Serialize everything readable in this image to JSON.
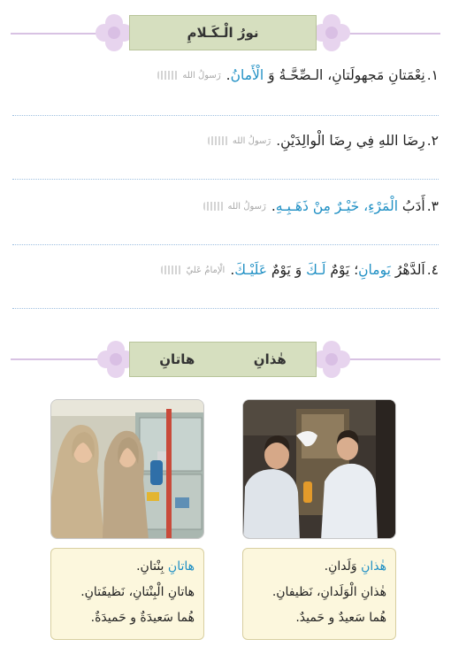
{
  "section1": {
    "title": "نورُ الْـكَـلامِ",
    "hadiths": [
      {
        "num": "١.",
        "parts": [
          {
            "t": "نِعْمَتانِ مَجهولَتانِ، الـصِّحَّـةُ وَ ",
            "c": ""
          },
          {
            "t": "الْأَمانُ",
            "c": "blue"
          },
          {
            "t": ".",
            "c": ""
          }
        ],
        "source": "رَسولُ الله"
      },
      {
        "num": "٢.",
        "parts": [
          {
            "t": "رِضَا اللهِ فِي رِضَا الْوالِدَيْنِ.",
            "c": ""
          }
        ],
        "source": "رَسولُ الله"
      },
      {
        "num": "٣.",
        "parts": [
          {
            "t": "أَدَبُ ",
            "c": ""
          },
          {
            "t": "الْمَرْءِ، خَيْـرٌ مِنْ ذَهَـبِـهِ",
            "c": "blue"
          },
          {
            "t": ".",
            "c": ""
          }
        ],
        "source": "رَسولُ الله"
      },
      {
        "num": "٤.",
        "parts": [
          {
            "t": "اَلدَّهْرُ ",
            "c": ""
          },
          {
            "t": "يَومانِ",
            "c": "blue"
          },
          {
            "t": "؛ يَوْمٌ ",
            "c": ""
          },
          {
            "t": "لَـكَ",
            "c": "blue"
          },
          {
            "t": " وَ يَوْمٌ ",
            "c": ""
          },
          {
            "t": "عَلَيْـكَ",
            "c": "blue"
          },
          {
            "t": ".",
            "c": ""
          }
        ],
        "source": "الْإمامُ عَليّ"
      }
    ]
  },
  "section2": {
    "label_right": "هٰذانِ",
    "label_left": "هاتانِ",
    "boys": {
      "l1_blue": "هٰذانِ",
      "l1_rest": " وَلَدانِ.",
      "l2": "هٰذانِ الْوَلَدانِ، نَظيفانِ.",
      "l3": "هُما سَعيدٌ و حَميدٌ."
    },
    "girls": {
      "l1_blue": "هاتانِ",
      "l1_rest": " بِنْتانِ.",
      "l2": "هاتانِ الْبِنْتانِ، نَظيفَتانِ.",
      "l3": "هُما سَعيدَةٌ و حَميدَةٌ."
    }
  },
  "colors": {
    "accent_blue": "#1e8fc4",
    "banner_green": "#d6dfbf",
    "flower_purple": "#e7d4ee",
    "caption_bg": "#fcf7dd"
  }
}
